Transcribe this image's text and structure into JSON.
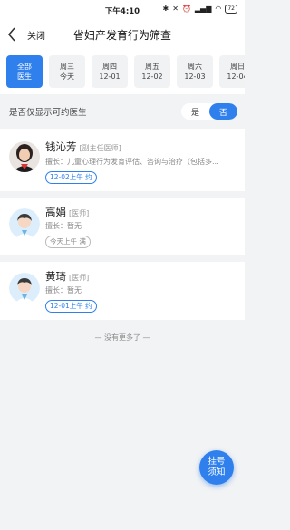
{
  "status_bar": {
    "time": "下午4:10",
    "battery": "72"
  },
  "nav": {
    "close_label": "关闭",
    "title": "省妇产发育行为筛查"
  },
  "dates": [
    {
      "line1": "全部",
      "line2": "医生",
      "active": true
    },
    {
      "line1": "周三",
      "line2": "今天",
      "active": false
    },
    {
      "line1": "周四",
      "line2": "12-01",
      "active": false
    },
    {
      "line1": "周五",
      "line2": "12-02",
      "active": false
    },
    {
      "line1": "周六",
      "line2": "12-03",
      "active": false
    },
    {
      "line1": "周日",
      "line2": "12-04",
      "active": false
    }
  ],
  "filter": {
    "label": "是否仅显示可约医生",
    "yes": "是",
    "no": "否"
  },
  "doctors": [
    {
      "name": "钱沁芳",
      "title": "[副主任医师]",
      "specialty": "擅长：儿童心理行为发育评估、咨询与治疗（包括多...",
      "slot": "12-02上午 约",
      "slot_full": false
    },
    {
      "name": "高娟",
      "title": "[医师]",
      "specialty": "擅长：暂无",
      "slot": "今天上午 满",
      "slot_full": true
    },
    {
      "name": "黄琦",
      "title": "[医师]",
      "specialty": "擅长：暂无",
      "slot": "12-01上午 约",
      "slot_full": false
    }
  ],
  "footer": {
    "no_more": "— 没有更多了 —"
  },
  "fab": {
    "line1": "挂号",
    "line2": "须知"
  },
  "colors": {
    "accent": "#2f80ed"
  }
}
